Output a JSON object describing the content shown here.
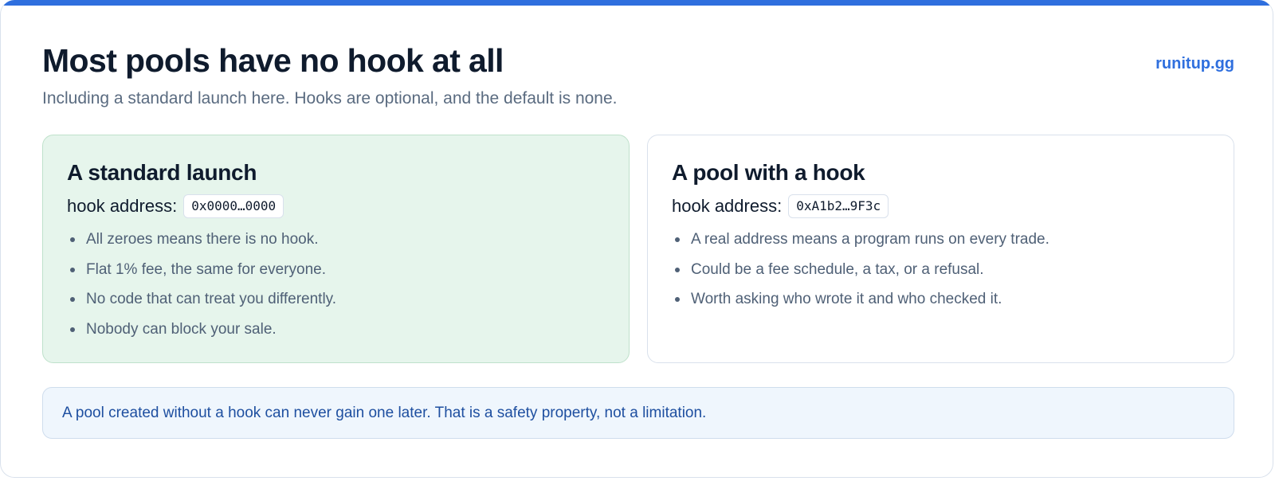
{
  "header": {
    "title": "Most pools have no hook at all",
    "subtitle": "Including a standard launch here. Hooks are optional, and the default is none.",
    "brand_link": "runitup.gg"
  },
  "cards": {
    "standard": {
      "title": "A standard launch",
      "address_label": "hook address:",
      "address_value": "0x0000…0000",
      "bullets": [
        "All zeroes means there is no hook.",
        "Flat 1% fee, the same for everyone.",
        "No code that can treat you differently.",
        "Nobody can block your sale."
      ]
    },
    "hook": {
      "title": "A pool with a hook",
      "address_label": "hook address:",
      "address_value": "0xA1b2…9F3c",
      "bullets": [
        "A real address means a program runs on every trade.",
        "Could be a fee schedule, a tax, or a refusal.",
        "Worth asking who wrote it and who checked it."
      ]
    }
  },
  "note": {
    "text": "A pool created without a hook can never gain one later. That is a safety property, not a limitation."
  },
  "colors": {
    "accent": "#2f6fde",
    "safe_card_bg": "#e6f5ec",
    "note_bg": "#eff6fd",
    "note_text": "#1e4fa0"
  }
}
